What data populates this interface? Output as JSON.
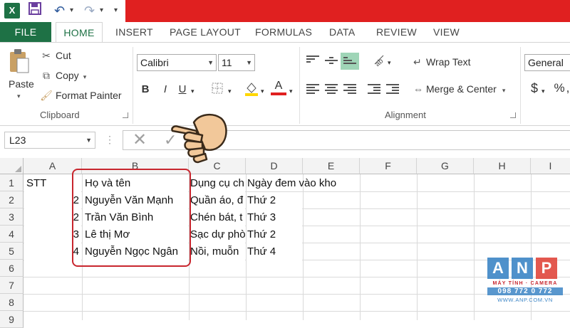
{
  "app": {
    "quick_access": {
      "app_icon": "excel-icon",
      "save_icon": "save-icon",
      "undo_icon": "undo-icon",
      "redo_icon": "redo-icon"
    }
  },
  "ribbon_tabs": [
    "FILE",
    "HOME",
    "INSERT",
    "PAGE LAYOUT",
    "FORMULAS",
    "DATA",
    "REVIEW",
    "VIEW"
  ],
  "clipboard": {
    "paste_label": "Paste",
    "cut_label": "Cut",
    "copy_label": "Copy",
    "format_painter_label": "Format Painter",
    "group_label": "Clipboard"
  },
  "font": {
    "font_name": "Calibri",
    "font_size": "11",
    "bold": "B",
    "italic": "I",
    "underline": "U",
    "highlight_color": "#ffd700",
    "font_color": "#e02020"
  },
  "alignment": {
    "wrap_text_label": "Wrap Text",
    "merge_center_label": "Merge & Center",
    "group_label": "Alignment"
  },
  "number": {
    "format": "General",
    "currency": "$",
    "percent": "%"
  },
  "formula_bar": {
    "name_box": "L23",
    "dots": "⋮",
    "cancel": "✕",
    "enter": "✓"
  },
  "grid": {
    "columns": [
      "A",
      "B",
      "C",
      "D",
      "E",
      "F",
      "G",
      "H",
      "I"
    ],
    "rows": [
      "1",
      "2",
      "3",
      "4",
      "5",
      "6",
      "7",
      "8",
      "9"
    ],
    "cells": {
      "A1": "STT",
      "B1": "Họ và tên",
      "C1": "Dụng cụ ch",
      "D1": "Ngày đem vào kho",
      "A2": "2",
      "B2": "Nguyễn Văn Mạnh",
      "C2": "Quần áo, đ",
      "D2": "Thứ 2",
      "A3": "2",
      "B3": "Trần Văn Bình",
      "C3": "Chén bát, t",
      "D3": "Thứ 3",
      "A4": "3",
      "B4": "Lê thị Mơ",
      "C4": "Sạc dự phò",
      "D4": "Thứ 2",
      "A5": "4",
      "B5": "Nguyễn Ngọc Ngân",
      "C5": "Nồi, muỗn",
      "D5": "Thứ 4"
    }
  },
  "watermark": {
    "letters": [
      "A",
      "N",
      "P"
    ],
    "tagline": "MÁY TÍNH · CAMERA",
    "phone": "098 772 0 772",
    "website": "WWW.ANP.COM.VN"
  },
  "colors": {
    "excel_green": "#1e7145",
    "titlebar_red": "#e02020",
    "highlight_border": "#c8262e",
    "anp_blue": "#3d86c6",
    "anp_red": "#e0473c"
  }
}
